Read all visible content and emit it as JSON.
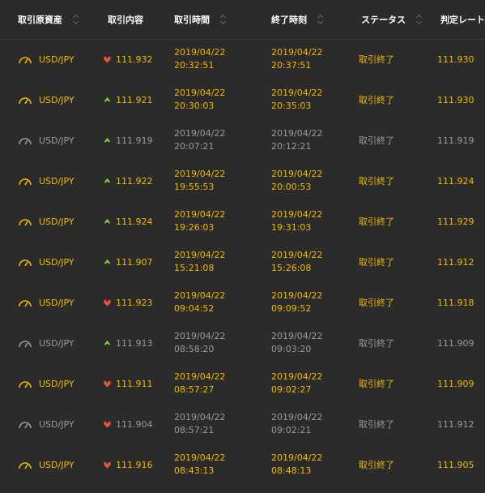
{
  "colors": {
    "background": "#2b2b2b",
    "header_text": "#ffffff",
    "win": "#f0b90b",
    "loss": "#9a9a9a",
    "arrow_up": "#8ad13c",
    "arrow_down": "#e8553b"
  },
  "headers": {
    "asset": "取引原資産",
    "content": "取引内容",
    "entry_time": "取引時間",
    "end_time": "終了時刻",
    "status": "ステータス",
    "rate": "判定レート"
  },
  "rows": [
    {
      "asset": "USD/JPY",
      "direction": "down",
      "rate_open": "111.932",
      "entry_date": "2019/04/22",
      "entry_time": "20:32:51",
      "end_date": "2019/04/22",
      "end_time": "20:37:51",
      "status": "取引終了",
      "judge_rate": "111.930",
      "result": "win"
    },
    {
      "asset": "USD/JPY",
      "direction": "up",
      "rate_open": "111.921",
      "entry_date": "2019/04/22",
      "entry_time": "20:30:03",
      "end_date": "2019/04/22",
      "end_time": "20:35:03",
      "status": "取引終了",
      "judge_rate": "111.930",
      "result": "win"
    },
    {
      "asset": "USD/JPY",
      "direction": "up",
      "rate_open": "111.919",
      "entry_date": "2019/04/22",
      "entry_time": "20:07:21",
      "end_date": "2019/04/22",
      "end_time": "20:12:21",
      "status": "取引終了",
      "judge_rate": "111.919",
      "result": "loss"
    },
    {
      "asset": "USD/JPY",
      "direction": "up",
      "rate_open": "111.922",
      "entry_date": "2019/04/22",
      "entry_time": "19:55:53",
      "end_date": "2019/04/22",
      "end_time": "20:00:53",
      "status": "取引終了",
      "judge_rate": "111.924",
      "result": "win"
    },
    {
      "asset": "USD/JPY",
      "direction": "up",
      "rate_open": "111.924",
      "entry_date": "2019/04/22",
      "entry_time": "19:26:03",
      "end_date": "2019/04/22",
      "end_time": "19:31:03",
      "status": "取引終了",
      "judge_rate": "111.929",
      "result": "win"
    },
    {
      "asset": "USD/JPY",
      "direction": "up",
      "rate_open": "111.907",
      "entry_date": "2019/04/22",
      "entry_time": "15:21:08",
      "end_date": "2019/04/22",
      "end_time": "15:26:08",
      "status": "取引終了",
      "judge_rate": "111.912",
      "result": "win"
    },
    {
      "asset": "USD/JPY",
      "direction": "down",
      "rate_open": "111.923",
      "entry_date": "2019/04/22",
      "entry_time": "09:04:52",
      "end_date": "2019/04/22",
      "end_time": "09:09:52",
      "status": "取引終了",
      "judge_rate": "111.918",
      "result": "win"
    },
    {
      "asset": "USD/JPY",
      "direction": "up",
      "rate_open": "111.913",
      "entry_date": "2019/04/22",
      "entry_time": "08:58:20",
      "end_date": "2019/04/22",
      "end_time": "09:03:20",
      "status": "取引終了",
      "judge_rate": "111.909",
      "result": "loss"
    },
    {
      "asset": "USD/JPY",
      "direction": "down",
      "rate_open": "111.911",
      "entry_date": "2019/04/22",
      "entry_time": "08:57:27",
      "end_date": "2019/04/22",
      "end_time": "09:02:27",
      "status": "取引終了",
      "judge_rate": "111.909",
      "result": "win"
    },
    {
      "asset": "USD/JPY",
      "direction": "down",
      "rate_open": "111.904",
      "entry_date": "2019/04/22",
      "entry_time": "08:57:21",
      "end_date": "2019/04/22",
      "end_time": "09:02:21",
      "status": "取引終了",
      "judge_rate": "111.912",
      "result": "loss"
    },
    {
      "asset": "USD/JPY",
      "direction": "down",
      "rate_open": "111.916",
      "entry_date": "2019/04/22",
      "entry_time": "08:43:13",
      "end_date": "2019/04/22",
      "end_time": "08:48:13",
      "status": "取引終了",
      "judge_rate": "111.905",
      "result": "win"
    }
  ]
}
